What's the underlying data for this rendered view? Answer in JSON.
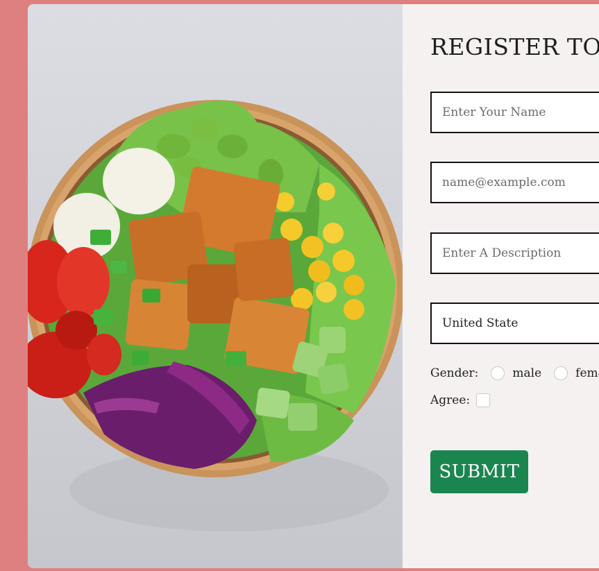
{
  "page": {
    "background_color": "#de8080",
    "accent_color": "#1b8550"
  },
  "hero_image": {
    "alt": "salad bowl"
  },
  "form": {
    "title": "REGISTER TO",
    "name_field": {
      "placeholder": "Enter Your Name",
      "value": ""
    },
    "email_field": {
      "placeholder": "name@example.com",
      "value": ""
    },
    "description_field": {
      "placeholder": "Enter A Description",
      "value": ""
    },
    "country_select": {
      "selected": "United State"
    },
    "gender": {
      "label": "Gender:",
      "options": [
        "male",
        "fema"
      ]
    },
    "agree": {
      "label": "Agree:"
    },
    "submit_label": "SUBMIT"
  }
}
